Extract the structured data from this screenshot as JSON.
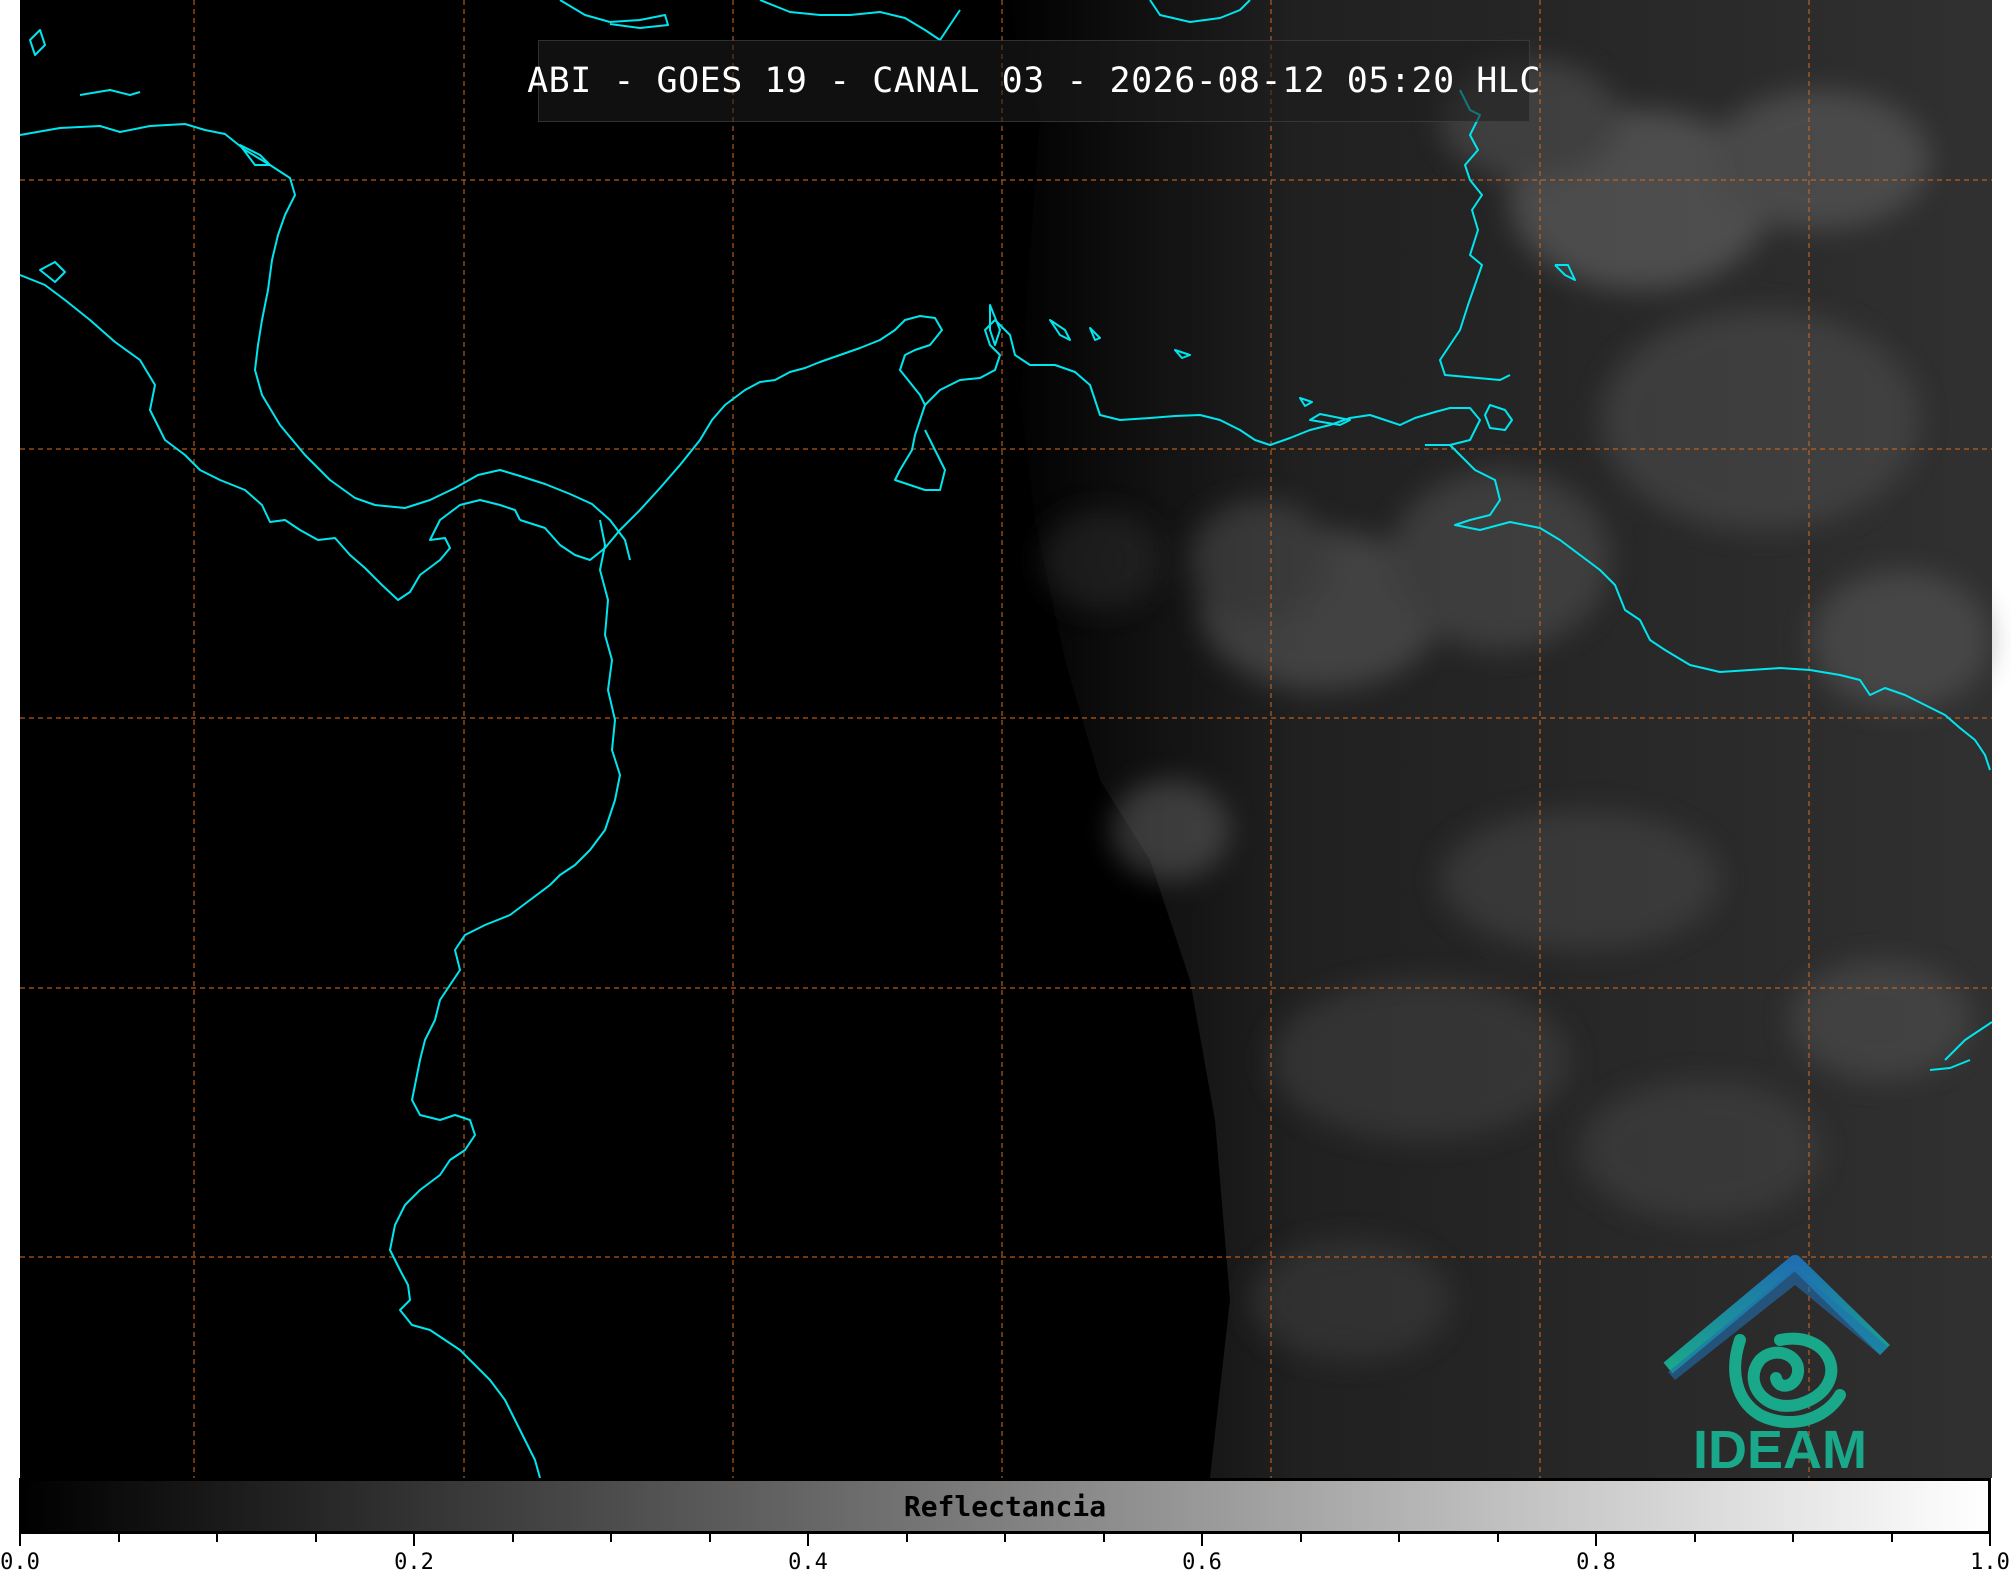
{
  "title": "ABI - GOES 19 - CANAL 03 - 2026-08-12 05:20 HLC",
  "colorbar": {
    "label": "Reflectancia",
    "ticks": [
      "0.0",
      "0.2",
      "0.4",
      "0.6",
      "0.8",
      "1.0"
    ],
    "min": 0.0,
    "max": 1.0,
    "colormap": "grayscale"
  },
  "logo": {
    "text": "IDEAM",
    "icon": "ideam-mountain-spiral-icon"
  },
  "colors": {
    "coastline": "#00e5ee",
    "gridlines": "#d2691e",
    "night_side": "#000000",
    "logo_teal": "#1aa88a",
    "logo_blue": "#1f6fb0"
  },
  "grid": {
    "visible": true,
    "style": "dashed"
  }
}
